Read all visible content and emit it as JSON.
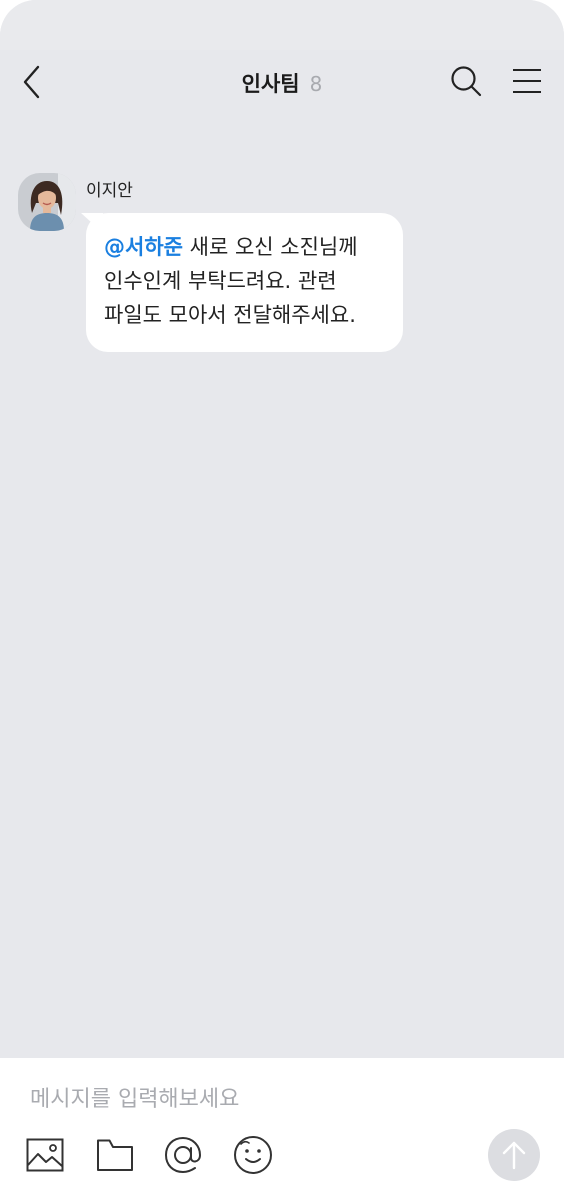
{
  "header": {
    "title": "인사팀",
    "member_count": "8"
  },
  "message": {
    "sender": "이지안",
    "mention": "@서하준",
    "text_line1": " 새로 오신 소진님께",
    "text_line2": "인수인계 부탁드려요. 관련",
    "text_line3": "파일도 모아서 전달해주세요."
  },
  "composer": {
    "placeholder": "메시지를 입력해보세요"
  },
  "icons": {
    "back": "chevron-left-icon",
    "search": "search-icon",
    "menu": "hamburger-menu-icon",
    "image": "image-icon",
    "folder": "folder-icon",
    "mention": "at-sign-icon",
    "emoji": "emoji-icon",
    "send": "arrow-up-icon"
  },
  "colors": {
    "background": "#e7e8ec",
    "mention": "#1a7fe0",
    "send_button": "#dcdde1"
  }
}
